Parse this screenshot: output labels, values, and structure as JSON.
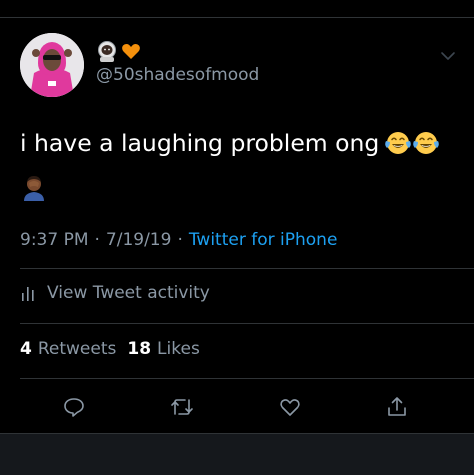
{
  "colors": {
    "background": "#000000",
    "primary_text": "#ffffff",
    "secondary_text": "#8b98a5",
    "link": "#1da1f2",
    "divider": "#2f3336",
    "avatar_hoodie": "#e0399d"
  },
  "header": {
    "display_name_emojis": [
      "astronaut-emoji",
      "orange-heart-emoji"
    ],
    "handle": "@50shadesofmood",
    "menu_icon": "chevron-down-icon"
  },
  "tweet": {
    "text": "i have a laughing problem ong",
    "trailing_emojis": [
      "tears-of-joy-emoji",
      "tears-of-joy-emoji"
    ],
    "second_line_emoji": "person-facepalming-emoji",
    "time": "9:37 PM",
    "date": "7/19/19",
    "separator": "·",
    "source": "Twitter for iPhone"
  },
  "activity": {
    "icon": "bar-chart-icon",
    "label": "View Tweet activity"
  },
  "stats": {
    "retweets_count": "4",
    "retweets_label": "Retweets",
    "likes_count": "18",
    "likes_label": "Likes"
  },
  "actions": [
    {
      "name": "reply-icon"
    },
    {
      "name": "retweet-icon"
    },
    {
      "name": "like-icon"
    },
    {
      "name": "share-icon"
    }
  ]
}
